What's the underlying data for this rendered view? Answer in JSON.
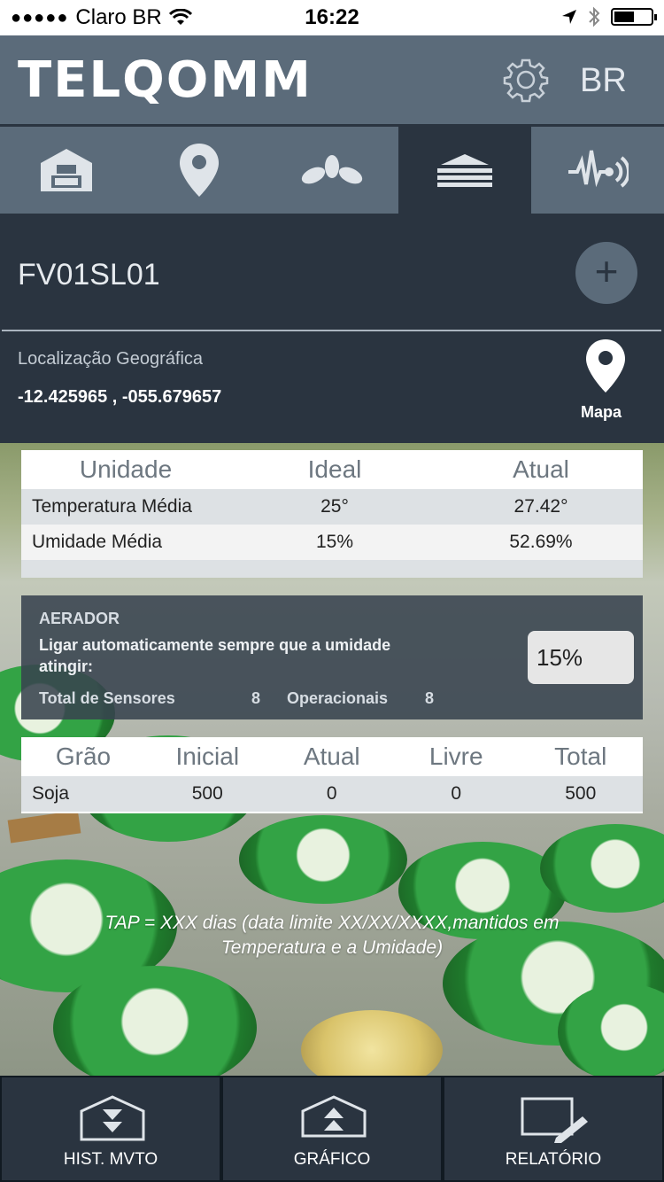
{
  "status_bar": {
    "carrier": "Claro BR",
    "time": "16:22"
  },
  "header": {
    "logo": "TELQOMM",
    "language": "BR",
    "settings_icon": "gear-icon"
  },
  "tabs": [
    {
      "icon": "barn-icon",
      "active": false
    },
    {
      "icon": "location-pin-icon",
      "active": false
    },
    {
      "icon": "leaf-sprout-icon",
      "active": false
    },
    {
      "icon": "silo-layers-icon",
      "active": true
    },
    {
      "icon": "sensor-signal-icon",
      "active": false
    }
  ],
  "silo": {
    "name": "FV01SL01",
    "geo_label": "Localização Geográfica",
    "geo_value": "-12.425965 , -055.679657",
    "map_label": "Mapa"
  },
  "units_table": {
    "headers": [
      "Unidade",
      "Ideal",
      "Atual"
    ],
    "rows": [
      [
        "Temperatura Média",
        "25°",
        "27.42°"
      ],
      [
        "Umidade Média",
        "15%",
        "52.69%"
      ]
    ]
  },
  "aerador": {
    "title": "AERADOR",
    "description": "Ligar automaticamente sempre que a umidade atingir:",
    "threshold": "15%",
    "sensors_label": "Total de Sensores",
    "sensors_value": "8",
    "operational_label": "Operacionais",
    "operational_value": "8"
  },
  "grain_table": {
    "headers": [
      "Grão",
      "Inicial",
      "Atual",
      "Livre",
      "Total"
    ],
    "rows": [
      [
        "Soja",
        "500",
        "0",
        "0",
        "500"
      ]
    ]
  },
  "tap_note": "TAP = XXX dias (data limite XX/XX/XXXX,mantidos em Temperatura e a Umidade)",
  "bottom_nav": {
    "hist": "HIST. MVTO",
    "grafico": "GRÁFICO",
    "relatorio": "RELATÓRIO"
  },
  "colors": {
    "header": "#5b6b7a",
    "panel": "#2a3440",
    "table_row": "#dde1e4"
  }
}
